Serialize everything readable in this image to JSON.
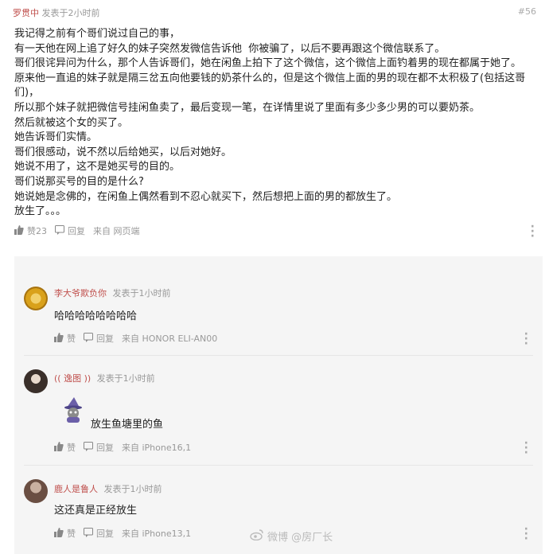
{
  "post": {
    "author": "罗贯中",
    "time": "发表于2小时前",
    "floor": "#56",
    "lines": [
      "我记得之前有个哥们说过自己的事，",
      "有一天他在网上追了好久的妹子突然发微信告诉他  你被骗了，以后不要再跟这个微信联系了。",
      "哥们很诧异问为什么，那个人告诉哥们，她在闲鱼上拍下了这个微信，这个微信上面钓着男的现在都属于她了。",
      "原来他一直追的妹子就是隔三岔五向他要钱的奶茶什么的，但是这个微信上面的男的现在都不太积极了(包括这哥",
      "们)，",
      "所以那个妹子就把微信号挂闲鱼卖了，最后变现一笔，在详情里说了里面有多少多少男的可以要奶茶。",
      "然后就被这个女的买了。",
      "她告诉哥们实情。",
      "哥们很感动，说不然以后给她买，以后对她好。",
      "她说不用了，这不是她买号的目的。",
      "哥们说那买号的目的是什么?",
      "她说她是念佛的，在闲鱼上偶然看到不忍心就买下，然后想把上面的男的都放生了。",
      "放生了。。。"
    ],
    "actions": {
      "like": "赞23",
      "reply": "回复",
      "source": "来自 网页端"
    }
  },
  "replies": [
    {
      "name": "李大爷欺负你",
      "time": "发表于1小时前",
      "text": "哈哈哈哈哈哈哈哈",
      "like": "赞",
      "reply": "回复",
      "source": "来自 HONOR  ELI-AN00"
    },
    {
      "name": "(( 逸图 ))",
      "time": "发表于1小时前",
      "text": "放生鱼塘里的鱼",
      "like": "赞",
      "reply": "回复",
      "source": "来自 iPhone16,1"
    },
    {
      "name": "鹿人是鲁人",
      "time": "发表于1小时前",
      "text": "这还真是正经放生",
      "like": "赞",
      "reply": "回复",
      "source": "来自 iPhone13,1"
    }
  ],
  "watermark": "微博 @房厂长",
  "colors": {
    "author": "#c0504d",
    "reply_bg": "#f5f5f5",
    "meta": "#999999"
  }
}
